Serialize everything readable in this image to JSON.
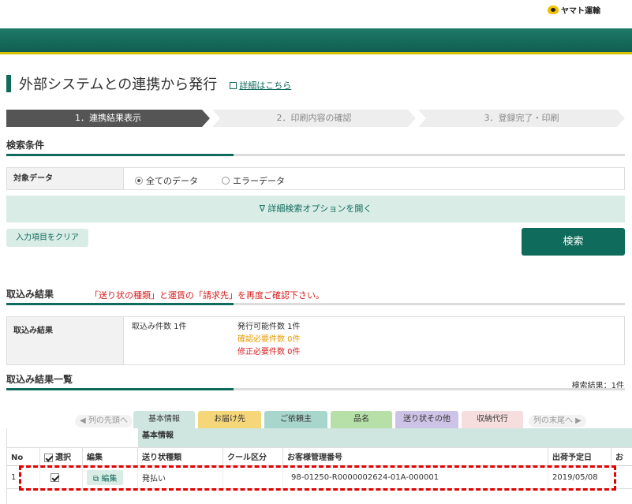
{
  "header": {
    "logo_text": "ヤマト運輸"
  },
  "page": {
    "title": "外部システムとの連携から発行",
    "detail_link": "詳細はこちら"
  },
  "steps": [
    "1．連携結果表示",
    "2．印刷内容の確認",
    "3．登録完了・印刷"
  ],
  "search": {
    "heading": "検索条件",
    "target_label": "対象データ",
    "options": [
      "全てのデータ",
      "エラーデータ"
    ],
    "selected": "全てのデータ",
    "advanced": "∇ 詳細検索オプションを開く",
    "clear": "入力項目をクリア",
    "submit": "検索"
  },
  "import": {
    "heading": "取込み結果",
    "warning": "「送り状の種類」と運賃の「請求先」を再度ご確認下さい。",
    "label": "取込み結果",
    "import_count": "取込み件数 1件",
    "issuable": "発行可能件数 1件",
    "check_needed": "確認必要件数 0件",
    "fix_needed": "修正必要件数 0件"
  },
  "list": {
    "heading": "取込み結果一覧",
    "result_count": "検索結果：1件",
    "nav_first": "列の先頭へ",
    "nav_last": "列の末尾へ",
    "tabs": [
      {
        "label": "基本情報",
        "color": "#cfe6e0"
      },
      {
        "label": "お届け先",
        "color": "#f5d77a"
      },
      {
        "label": "ご依頼主",
        "color": "#a8d5cc"
      },
      {
        "label": "品名",
        "color": "#b7e0a8"
      },
      {
        "label": "送り状その他",
        "color": "#cdc3e6"
      },
      {
        "label": "収納代行",
        "color": "#f7dede"
      }
    ],
    "group_header": "基本情報",
    "columns": [
      "No",
      "選択",
      "編集",
      "送り状種類",
      "クール区分",
      "お客様管理番号",
      "出荷予定日",
      "お"
    ],
    "row": {
      "no": "1",
      "edit": "編集",
      "slip_type": "発払い",
      "cool": "",
      "customer_no": "98-01250-R0000002624-01A-000001",
      "ship_date": "2019/05/08"
    }
  }
}
